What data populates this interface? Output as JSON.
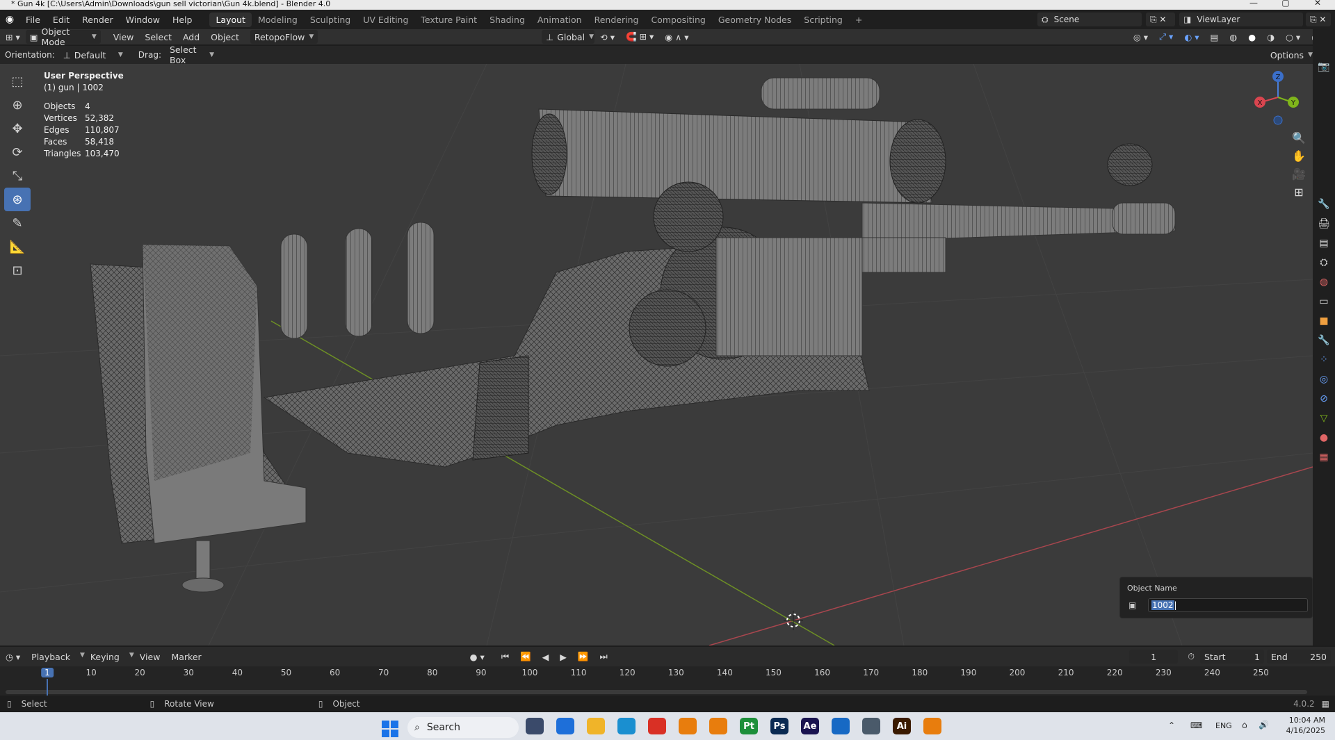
{
  "window": {
    "title": "* Gun 4k [C:\\Users\\Admin\\Downloads\\gun sell victorian\\Gun 4k.blend] - Blender 4.0"
  },
  "menu": {
    "items": [
      "File",
      "Edit",
      "Render",
      "Window",
      "Help"
    ]
  },
  "workspaces": {
    "tabs": [
      "Layout",
      "Modeling",
      "Sculpting",
      "UV Editing",
      "Texture Paint",
      "Shading",
      "Animation",
      "Rendering",
      "Compositing",
      "Geometry Nodes",
      "Scripting"
    ],
    "add": "+"
  },
  "scene": {
    "name": "Scene",
    "view_layer": "ViewLayer"
  },
  "header": {
    "mode": "Object Mode",
    "menus": [
      "View",
      "Select",
      "Add",
      "Object"
    ],
    "addon": "RetopoFlow",
    "transform_orientation": "Global",
    "orientation_label": "Orientation:",
    "orientation_value": "Default",
    "drag_label": "Drag:",
    "drag_value": "Select Box",
    "options": "Options"
  },
  "viewport": {
    "view_name": "User Perspective",
    "collection": "(1) gun | 1002",
    "stats": [
      {
        "k": "Objects",
        "v": "4"
      },
      {
        "k": "Vertices",
        "v": "52,382"
      },
      {
        "k": "Edges",
        "v": "110,807"
      },
      {
        "k": "Faces",
        "v": "58,418"
      },
      {
        "k": "Triangles",
        "v": "103,470"
      }
    ],
    "gizmo": {
      "x": "X",
      "y": "Y",
      "z": "Z"
    }
  },
  "popup": {
    "label": "Object Name",
    "value": "1002"
  },
  "timeline": {
    "menus": [
      "Playback",
      "Keying",
      "View",
      "Marker"
    ],
    "current_frame": "1",
    "start_label": "Start",
    "start": "1",
    "end_label": "End",
    "end": "250",
    "ticks": [
      "1",
      "10",
      "20",
      "30",
      "40",
      "50",
      "60",
      "70",
      "80",
      "90",
      "100",
      "110",
      "120",
      "130",
      "140",
      "150",
      "160",
      "170",
      "180",
      "190",
      "200",
      "210",
      "220",
      "230",
      "240",
      "250"
    ]
  },
  "status": {
    "select": "Select",
    "rotate": "Rotate View",
    "object": "Object",
    "version": "4.0.2"
  },
  "taskbar": {
    "search": "Search",
    "lang": "ENG",
    "time": "10:04 AM",
    "date": "4/16/2025",
    "apps": [
      {
        "name": "pen-app",
        "label": "",
        "color": "#3a4a6a"
      },
      {
        "name": "app-blue",
        "label": "",
        "color": "#1e6fd9"
      },
      {
        "name": "file-explorer",
        "label": "",
        "color": "#f0b429"
      },
      {
        "name": "edge",
        "label": "",
        "color": "#1a8fd0"
      },
      {
        "name": "chrome",
        "label": "",
        "color": "#d93025"
      },
      {
        "name": "blender-a",
        "label": "",
        "color": "#e87d0d"
      },
      {
        "name": "blender-b",
        "label": "",
        "color": "#e87d0d"
      },
      {
        "name": "pycharm",
        "label": "Pt",
        "color": "#1d8f3a"
      },
      {
        "name": "photoshop",
        "label": "Ps",
        "color": "#0a2a52"
      },
      {
        "name": "after-effects",
        "label": "Ae",
        "color": "#1a1450"
      },
      {
        "name": "store",
        "label": "",
        "color": "#1769c4"
      },
      {
        "name": "app-figure",
        "label": "",
        "color": "#4a5a6a"
      },
      {
        "name": "illustrator",
        "label": "Ai",
        "color": "#3a1a00"
      },
      {
        "name": "blender-c",
        "label": "",
        "color": "#e87d0d"
      }
    ]
  }
}
